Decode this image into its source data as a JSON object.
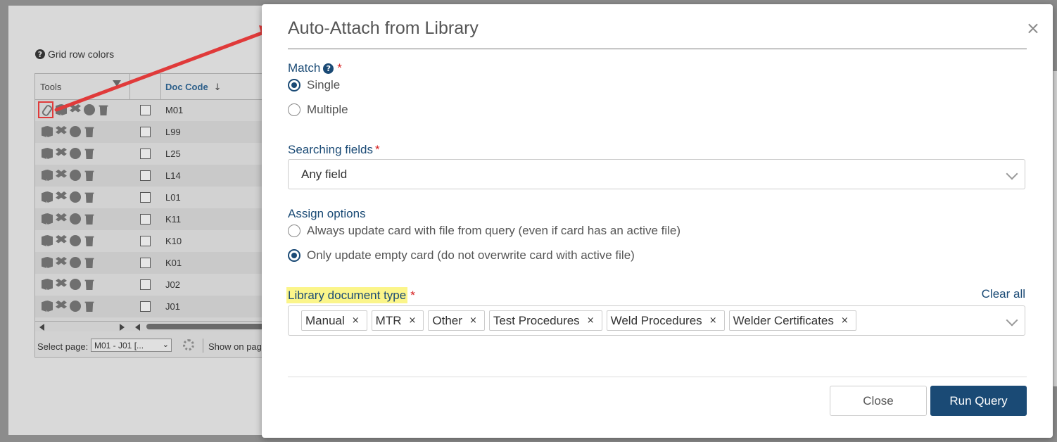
{
  "background": {
    "grid_row_colors_label": "Grid row colors",
    "columns": {
      "tools": "Tools",
      "doc_code": "Doc Code"
    },
    "rows": [
      "M01",
      "L99",
      "L25",
      "L14",
      "L01",
      "K11",
      "K10",
      "K01",
      "J02",
      "J01"
    ],
    "footer": {
      "select_page_label": "Select page:",
      "select_page_value": "M01 - J01 [...",
      "show_on_page": "Show on page"
    }
  },
  "dialog": {
    "title": "Auto-Attach from Library",
    "match": {
      "label": "Match",
      "options": [
        "Single",
        "Multiple"
      ],
      "selected": "Single"
    },
    "searching_fields": {
      "label": "Searching fields",
      "value": "Any field"
    },
    "assign_options": {
      "label": "Assign options",
      "options": [
        "Always update card with file from query (even if card has an active file)",
        "Only update empty card (do not overwrite card with active file)"
      ],
      "selected": "Only update empty card (do not overwrite card with active file)"
    },
    "library_document_type": {
      "label": "Library document type",
      "clear_all": "Clear all",
      "tags": [
        "Manual",
        "MTR",
        "Other",
        "Test Procedures",
        "Weld Procedures",
        "Welder Certificates"
      ]
    },
    "buttons": {
      "close": "Close",
      "run_query": "Run Query"
    },
    "required_marker": "*",
    "close_icon": "×",
    "tag_remove_icon": "×"
  },
  "colors": {
    "accent": "#1a4a75",
    "required": "#d62020",
    "highlight": "#fbf58a",
    "annotation": "#e03a3a"
  }
}
